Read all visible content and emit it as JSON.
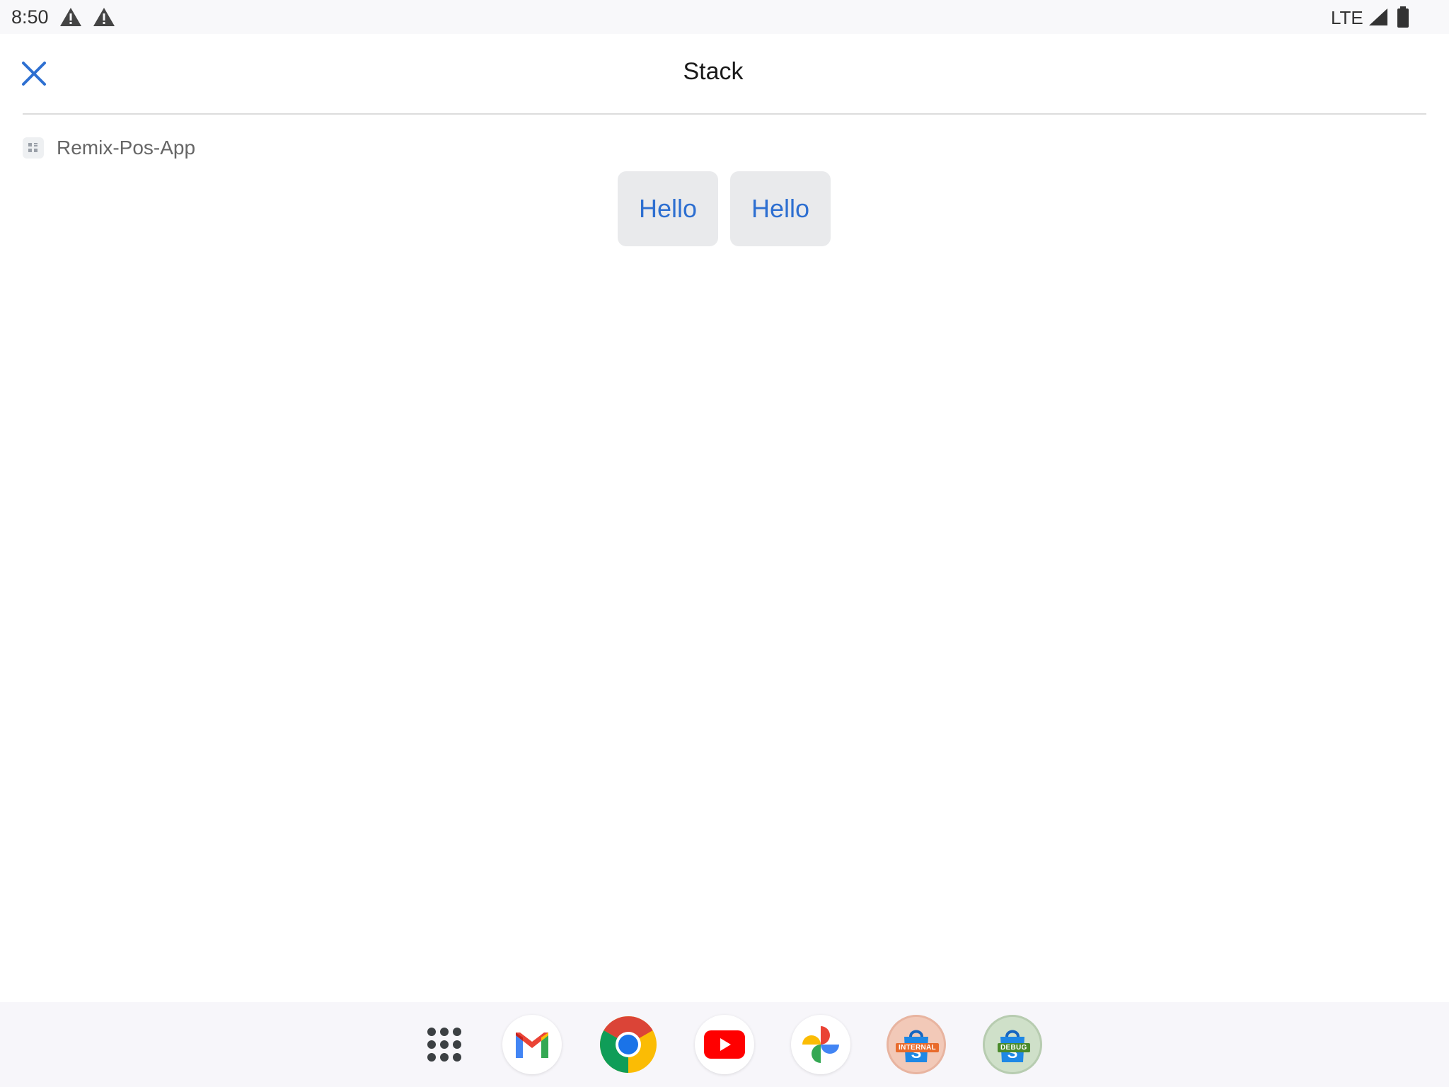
{
  "status_bar": {
    "time": "8:50",
    "icons": [
      "warning-icon",
      "warning-icon",
      "signal-icon",
      "battery-icon"
    ],
    "network": "LTE"
  },
  "header": {
    "title": "Stack",
    "close_icon": "close-icon"
  },
  "app": {
    "name": "Remix-Pos-App",
    "icon": "app-grid-icon"
  },
  "buttons": [
    {
      "label": "Hello"
    },
    {
      "label": "Hello"
    }
  ],
  "dock": {
    "items": [
      {
        "name": "app-drawer",
        "icon": "apps-grid-icon"
      },
      {
        "name": "gmail",
        "icon": "gmail-icon"
      },
      {
        "name": "chrome",
        "icon": "chrome-icon"
      },
      {
        "name": "youtube",
        "icon": "youtube-icon"
      },
      {
        "name": "photos",
        "icon": "photos-icon"
      },
      {
        "name": "shopify-internal",
        "icon": "shopify-bag-icon",
        "badge": "INTERNAL"
      },
      {
        "name": "shopify-debug",
        "icon": "shopify-bag-icon",
        "badge": "DEBUG"
      }
    ]
  },
  "colors": {
    "accent": "#2d6fd1",
    "button_bg": "#e9eaec",
    "dock_bg": "#f7f6fa",
    "status_bg": "#f8f8fa"
  }
}
